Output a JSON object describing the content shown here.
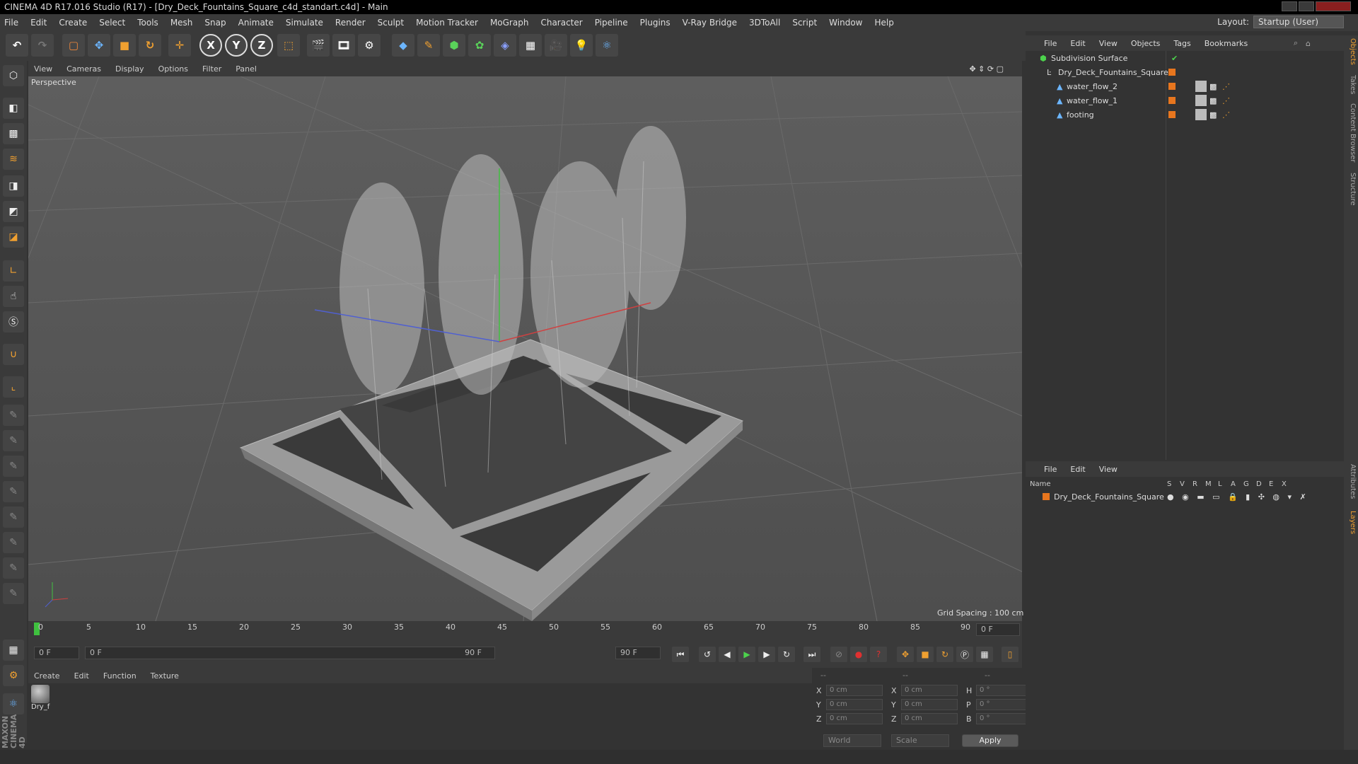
{
  "window": {
    "title": "CINEMA 4D R17.016 Studio (R17) - [Dry_Deck_Fountains_Square_c4d_standart.c4d] - Main"
  },
  "menubar": {
    "items": [
      "File",
      "Edit",
      "Create",
      "Select",
      "Tools",
      "Mesh",
      "Snap",
      "Animate",
      "Simulate",
      "Render",
      "Sculpt",
      "Motion Tracker",
      "MoGraph",
      "Character",
      "Pipeline",
      "Plugins",
      "V-Ray Bridge",
      "3DToAll",
      "Script",
      "Window",
      "Help"
    ]
  },
  "layout": {
    "label": "Layout:",
    "value": "Startup (User)"
  },
  "toolbar": {
    "x_label": "X",
    "y_label": "Y",
    "z_label": "Z"
  },
  "viewport": {
    "menu": [
      "View",
      "Cameras",
      "Display",
      "Options",
      "Filter",
      "Panel"
    ],
    "label": "Perspective",
    "grid_spacing": "Grid Spacing : 100 cm"
  },
  "timeline": {
    "ticks": [
      "0",
      "5",
      "10",
      "15",
      "20",
      "25",
      "30",
      "35",
      "40",
      "45",
      "50",
      "55",
      "60",
      "65",
      "70",
      "75",
      "80",
      "85",
      "90"
    ],
    "current_frame": "0 F"
  },
  "transport": {
    "start_field": "0 F",
    "range_start": "0 F",
    "range_end": "90 F",
    "end_field": "90 F"
  },
  "materials": {
    "menu": [
      "Create",
      "Edit",
      "Function",
      "Texture"
    ],
    "items": [
      {
        "label": "Dry_f"
      }
    ]
  },
  "coords": {
    "headers": [
      "--",
      "--",
      "--"
    ],
    "rows": [
      {
        "a": "X",
        "av": "0 cm",
        "b": "X",
        "bv": "0 cm",
        "c": "H",
        "cv": "0 °"
      },
      {
        "a": "Y",
        "av": "0 cm",
        "b": "Y",
        "bv": "0 cm",
        "c": "P",
        "cv": "0 °"
      },
      {
        "a": "Z",
        "av": "0 cm",
        "b": "Z",
        "bv": "0 cm",
        "c": "B",
        "cv": "0 °"
      }
    ],
    "world": "World",
    "scale": "Scale",
    "apply": "Apply"
  },
  "objects_panel": {
    "menu": [
      "File",
      "Edit",
      "View",
      "Objects",
      "Tags",
      "Bookmarks"
    ],
    "rows": [
      {
        "name": "Subdivision Surface"
      },
      {
        "name": "Dry_Deck_Fountains_Square"
      },
      {
        "name": "water_flow_2"
      },
      {
        "name": "water_flow_1"
      },
      {
        "name": "footing"
      }
    ]
  },
  "layers_panel": {
    "menu": [
      "File",
      "Edit",
      "View"
    ],
    "name_header": "Name",
    "cols": [
      "S",
      "V",
      "R",
      "M",
      "L",
      "A",
      "G",
      "D",
      "E",
      "X"
    ],
    "rows": [
      {
        "name": "Dry_Deck_Fountains_Square"
      }
    ]
  },
  "right_tabs": [
    "Objects",
    "Takes",
    "Content Browser",
    "Structure",
    "Attributes",
    "Layers"
  ],
  "brand": {
    "maxon": "MAXON",
    "cinema": "CINEMA 4D"
  },
  "colors": {
    "accent": "#e8761e",
    "viewport": "#565656",
    "panel": "#333333"
  }
}
